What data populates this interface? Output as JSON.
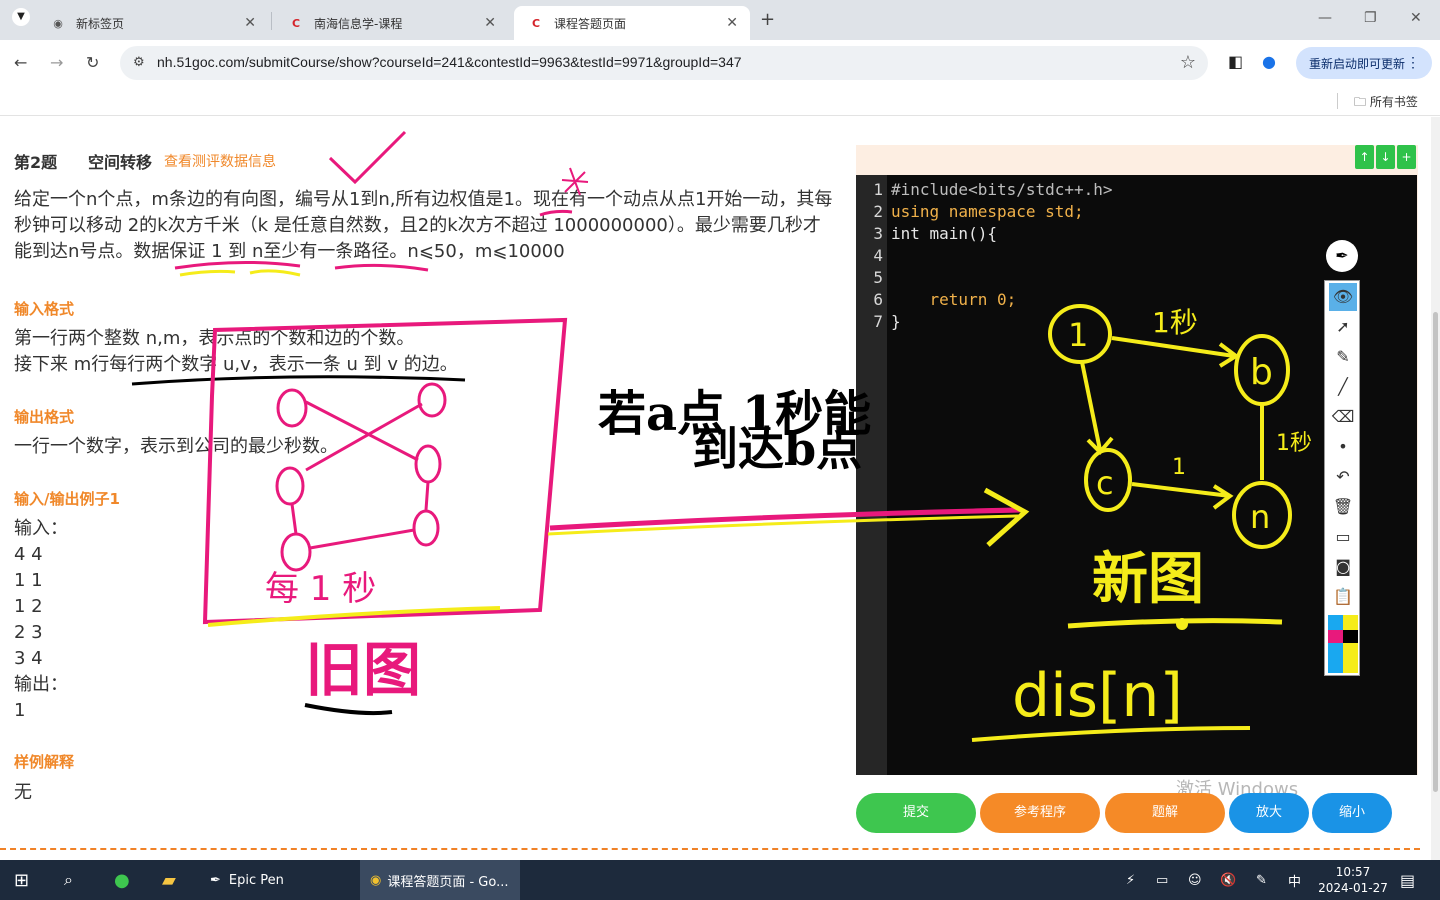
{
  "browser": {
    "tabs": [
      {
        "title": "新标签页",
        "favicon": "chrome-icon"
      },
      {
        "title": "南海信息学-课程",
        "favicon": "c-logo-icon"
      },
      {
        "title": "课程答题页面",
        "favicon": "c-logo-icon",
        "active": true
      }
    ],
    "url": "nh.51goc.com/submitCourse/show?courseId=241&contestId=9963&testId=9971&groupId=347",
    "restart_label": "重新启动即可更新",
    "all_bookmarks": "所有书签"
  },
  "problem": {
    "number": "第2题",
    "title": "空间转移",
    "view_data_link": "查看测评数据信息",
    "description": "给定一个n个点，m条边的有向图，编号从1到n,所有边权值是1。现在有一个动点从点1开始一动，其每秒钟可以移动 2的k次方千米（k 是任意自然数，且2的k次方不超过 1000000000）。最少需要几秒才能到达n号点。数据保证 1 到 n至少有一条路径。n⩽50，m⩽10000",
    "input_format_title": "输入格式",
    "input_format_lines": [
      "第一行两个整数 n,m，表示点的个数和边的个数。",
      "接下来 m行每行两个数字 u,v，表示一条 u 到 v 的边。"
    ],
    "output_format_title": "输出格式",
    "output_format_text": "一行一个数字，表示到公司的最少秒数。",
    "example_title": "输入/输出例子1",
    "example_input_label": "输入：",
    "example_input": [
      "4 4",
      "1 1",
      "1 2",
      "2 3",
      "3 4"
    ],
    "example_output_label": "输出：",
    "example_output": "1",
    "explain_title": "样例解释",
    "explain_text": "无"
  },
  "editor": {
    "lines": [
      "#include<bits/stdc++.h>",
      "using namespace std;",
      "int main(){",
      "",
      "",
      "    return 0;",
      "}"
    ],
    "line_numbers": [
      "1",
      "2",
      "3",
      "4",
      "5",
      "6",
      "7"
    ],
    "buttons": [
      "↑",
      "↓",
      "+"
    ]
  },
  "actions": {
    "submit": "提交",
    "reference": "参考程序",
    "solution": "题解",
    "zoom_in": "放大",
    "zoom_out": "缩小"
  },
  "watermark": "激活 Windows",
  "annotations": {
    "text_a": "若a点 1秒能",
    "text_b": "到达b点",
    "old_graph": "旧图",
    "per_second": "每 1 秒",
    "new_graph": "新图",
    "dist": "dis[n]",
    "node_1": "1",
    "node_b": "b",
    "node_c": "c",
    "node_n": "n",
    "edge_1s": "1秒",
    "edge_1": "1",
    "edge_1_right": "1秒"
  },
  "taskbar": {
    "epic_pen": "Epic Pen",
    "chrome_window": "课程答题页面 - Go...",
    "ime": "中",
    "time": "10:57",
    "date": "2024-01-27"
  },
  "colors": {
    "accent": "#f0882a",
    "submit": "#3ec64f",
    "orange_btn": "#f58a27",
    "blue_btn": "#1a93e6",
    "annotation_pink": "#e8197c",
    "annotation_yellow": "#f5ec1a",
    "editor_bg": "#0b0b0b"
  }
}
